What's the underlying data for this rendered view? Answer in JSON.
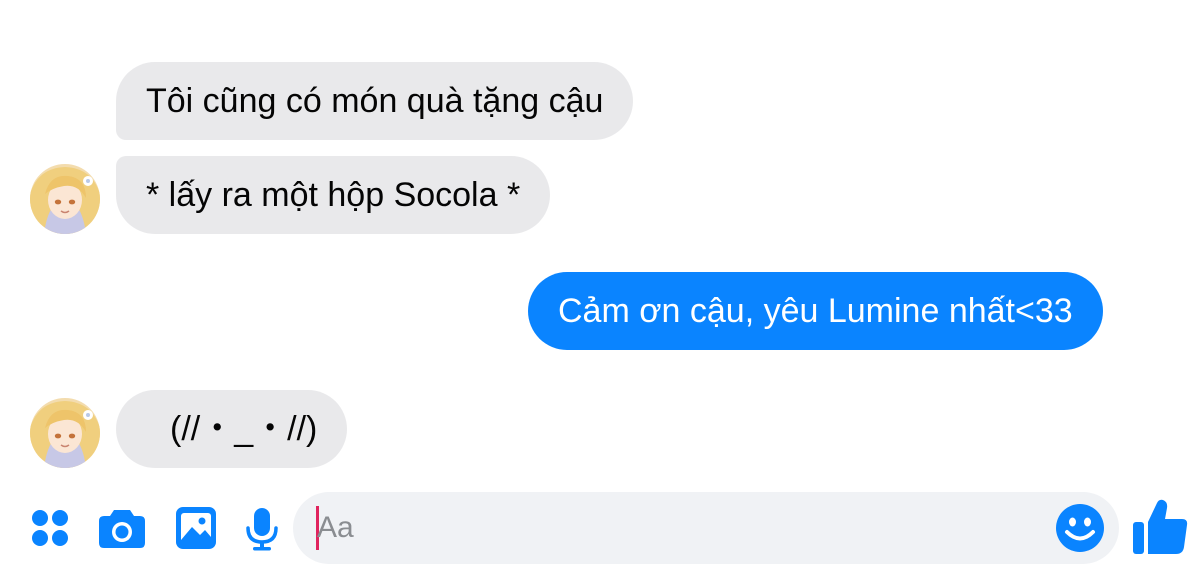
{
  "messages": [
    {
      "sender": "other",
      "text": "Tôi cũng có món quà tặng cậu"
    },
    {
      "sender": "other",
      "text": "* lấy ra một hộp Socola *"
    },
    {
      "sender": "me",
      "text": "Cảm ơn cậu, yêu Lumine nhất<33"
    },
    {
      "sender": "other",
      "text": "(//・_・//)"
    }
  ],
  "composer": {
    "placeholder": "Aa"
  },
  "toolbar": {
    "icons": [
      "apps-icon",
      "camera-icon",
      "image-icon",
      "microphone-icon",
      "emoji-icon",
      "thumbs-up-icon"
    ]
  },
  "colors": {
    "accent": "#0a84ff",
    "incoming_bubble": "#e9e9eb",
    "composer_bg": "#f0f2f5",
    "caret": "#e0245e"
  }
}
